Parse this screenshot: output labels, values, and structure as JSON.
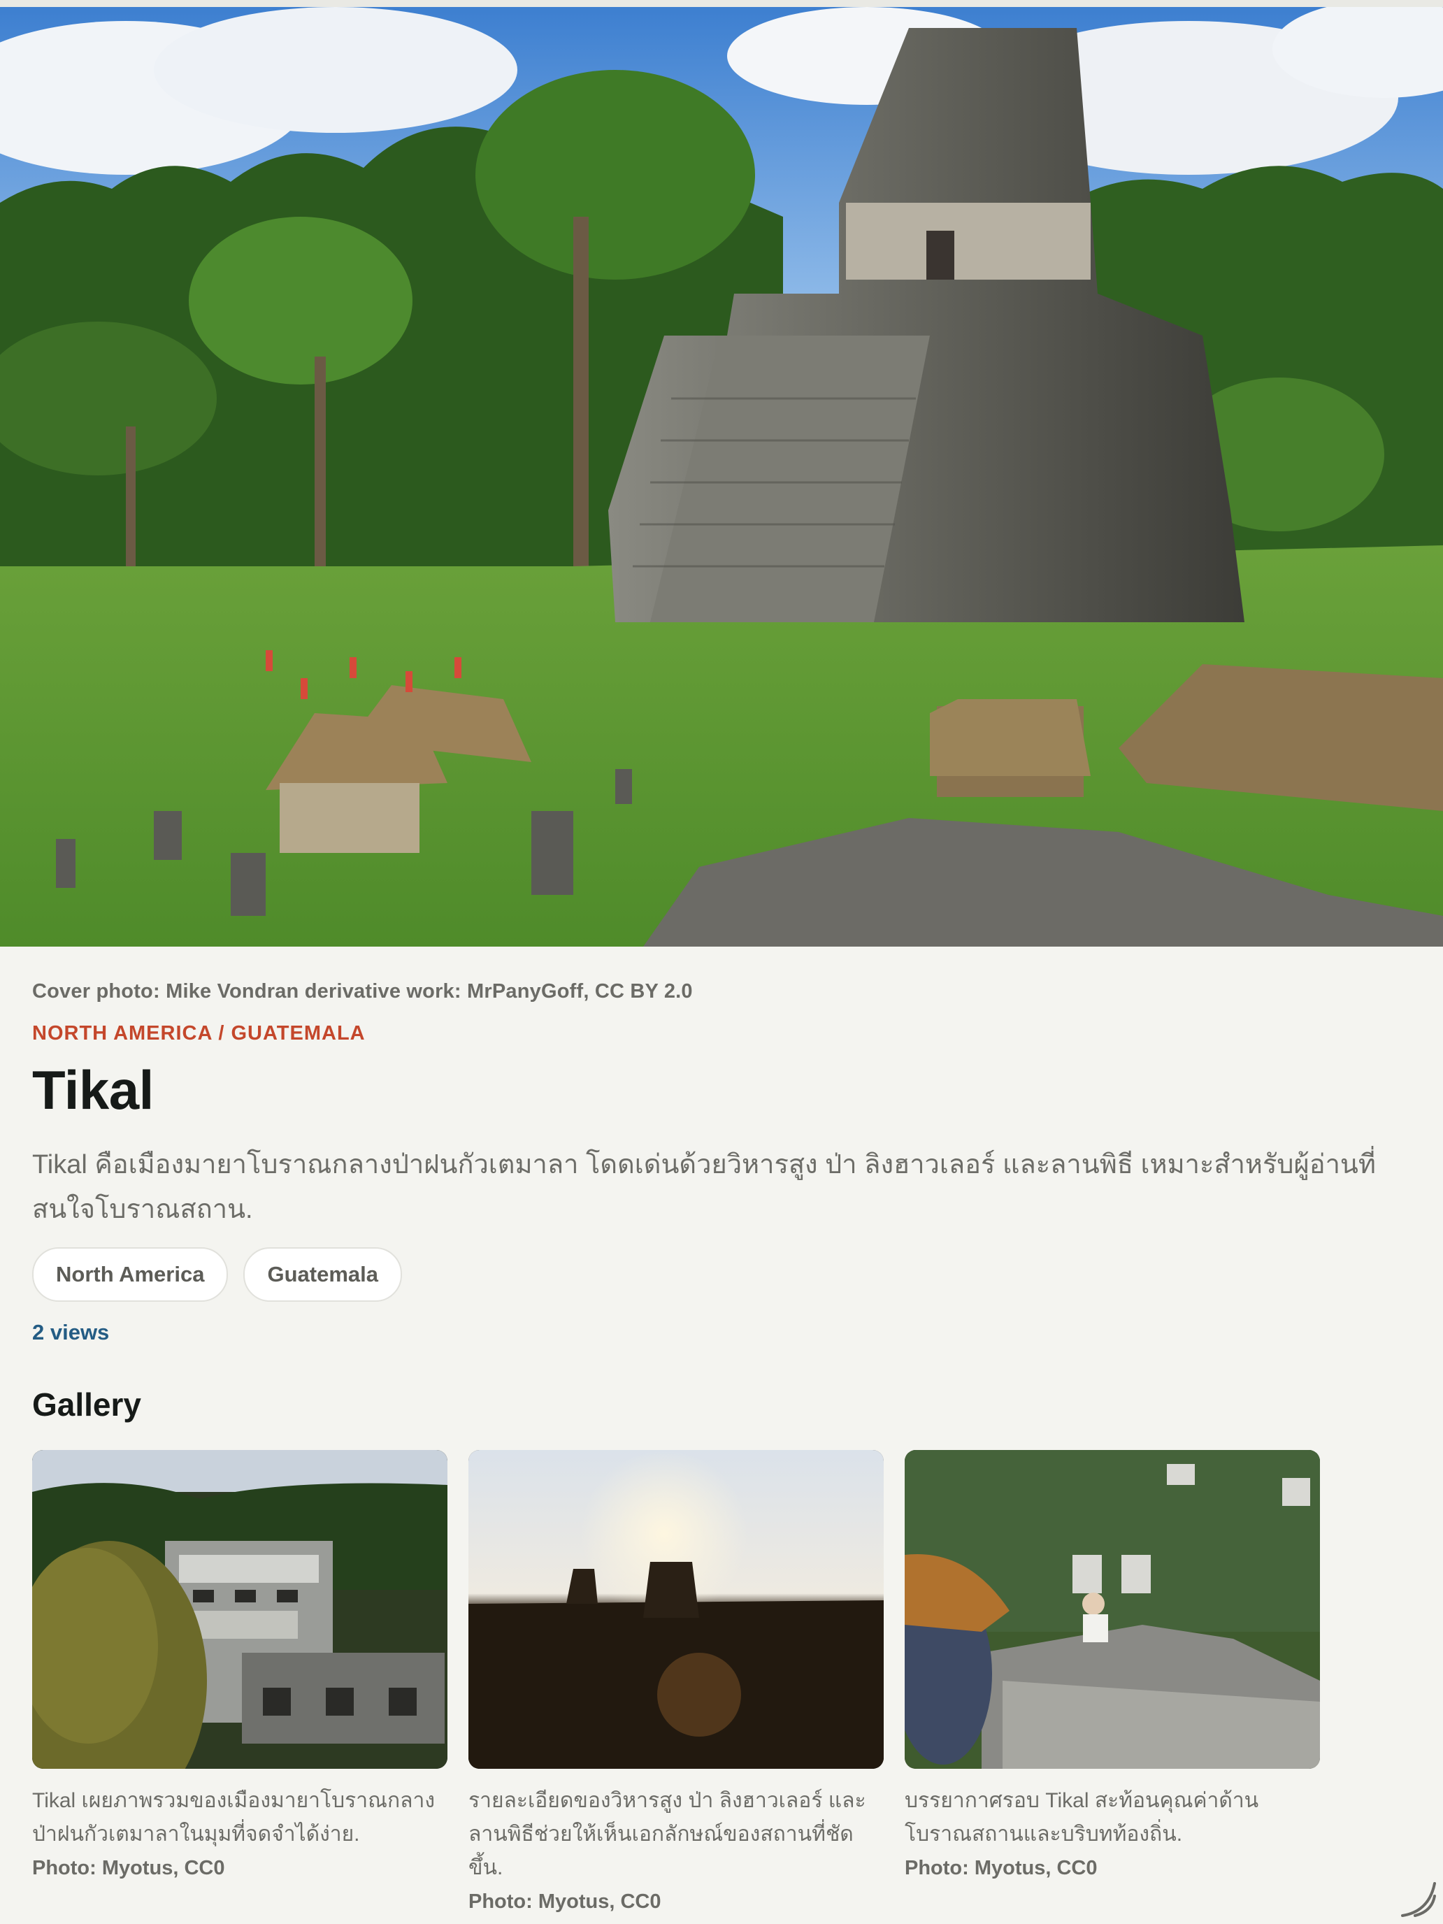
{
  "hero": {
    "image_alt": "Tikal temple pyramid in a grassy plaza surrounded by rainforest"
  },
  "cover_credit": "Cover photo: Mike Vondran derivative work: MrPanyGoff, CC BY 2.0",
  "breadcrumb": "NORTH AMERICA / GUATEMALA",
  "title": "Tikal",
  "description": "Tikal คือเมืองมายาโบราณกลางป่าฝนกัวเตมาลา โดดเด่นด้วยวิหารสูง ป่า ลิงฮาวเลอร์ และลานพิธี เหมาะสำหรับผู้อ่านที่สนใจโบราณสถาน.",
  "tags": [
    "North America",
    "Guatemala"
  ],
  "views": "2 views",
  "gallery": {
    "heading": "Gallery",
    "items": [
      {
        "caption": "Tikal เผยภาพรวมของเมืองมายาโบราณกลางป่าฝนกัวเตมาลาในมุมที่จดจำได้ง่าย.",
        "credit": "Photo: Myotus, CC0"
      },
      {
        "caption": "รายละเอียดของวิหารสูง ป่า ลิงฮาวเลอร์ และลานพิธีช่วยให้เห็นเอกลักษณ์ของสถานที่ชัดขึ้น.",
        "credit": "Photo: Myotus, CC0"
      },
      {
        "caption": "บรรยากาศรอบ Tikal สะท้อนคุณค่าด้านโบราณสถานและบริบทท้องถิ่น.",
        "credit": "Photo: Myotus, CC0"
      }
    ]
  },
  "colors": {
    "background": "#f4f4f0",
    "accent_region": "#c4472b",
    "views_link": "#245c84",
    "title": "#161a18"
  },
  "icons": [
    "resize-handle-icon"
  ]
}
